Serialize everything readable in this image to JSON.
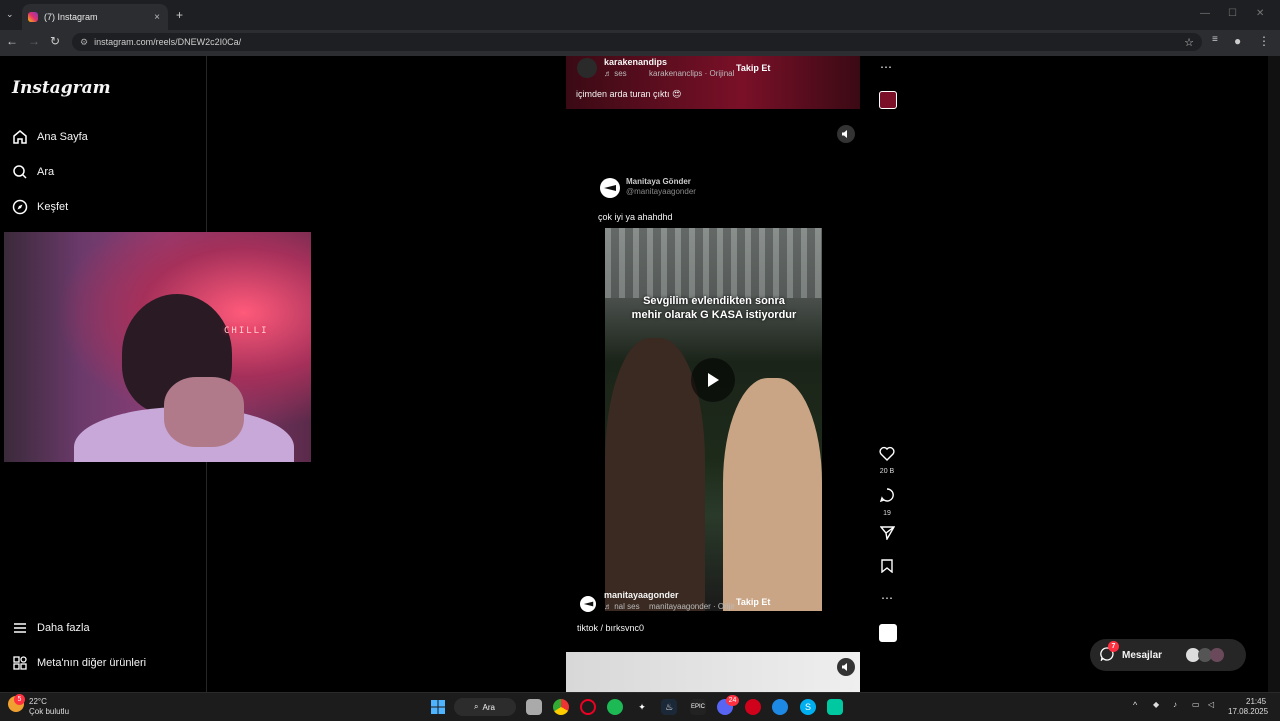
{
  "browser": {
    "tab_title": "(7) Instagram",
    "url": "instagram.com/reels/DNEW2c2I0Ca/",
    "tab_close": "×",
    "new_tab": "+"
  },
  "sidebar": {
    "logo": "Instagram",
    "items": [
      {
        "label": "Ana Sayfa",
        "icon": "home-icon"
      },
      {
        "label": "Ara",
        "icon": "search-icon"
      },
      {
        "label": "Keşfet",
        "icon": "compass-icon"
      }
    ],
    "bottom_items": [
      {
        "label": "Daha fazla",
        "icon": "menu-icon"
      },
      {
        "label": "Meta'nın diğer ürünleri",
        "icon": "apps-icon"
      }
    ]
  },
  "webcam": {
    "neon_text": "CHILLI"
  },
  "posts": {
    "top": {
      "username": "karakenandips",
      "audio_prefix": "♬ ses",
      "audio": "karakenanclips · Orijinal",
      "follow": "Takip Et",
      "caption": "içimden arda turan çıktı 😍"
    },
    "main": {
      "author": "Manitaya Gönder",
      "handle": "@manitayaagonder",
      "caption": "çok iyi ya ahahdhd",
      "video_caption": "Sevgilim evlendikten sonra mehir olarak G KASA istiyordur",
      "username": "manitayaagonder",
      "audio_prefix": "♬ nal ses",
      "audio": "manitayaagonder · Orijir",
      "follow": "Takip Et",
      "sub_caption": "tiktok / bırksvnc0",
      "likes": "20 B",
      "comments": "19"
    }
  },
  "messages": {
    "label": "Mesajlar",
    "badge": "7"
  },
  "taskbar": {
    "weather_temp": "22°C",
    "weather_desc": "Çok bulutlu",
    "weather_badge": "5",
    "search": "Ara",
    "discord_badge": "24",
    "time": "21:45",
    "date": "17.08.2025"
  }
}
